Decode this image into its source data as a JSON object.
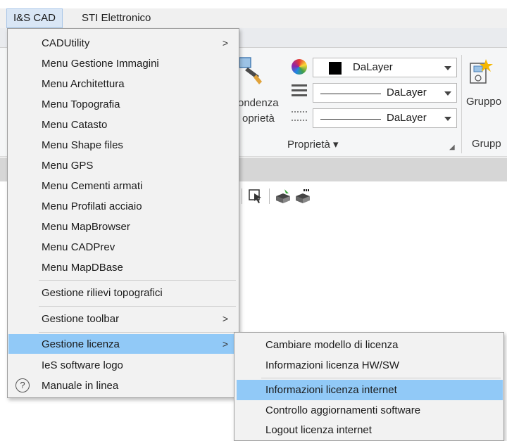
{
  "menubar": {
    "items": [
      {
        "label": "I&S CAD"
      },
      {
        "label": "STI Elettronico"
      }
    ]
  },
  "ribbon": {
    "match_label_1": "ondenza",
    "match_label_2": "oprietà",
    "color_value": "DaLayer",
    "linetype_value": "DaLayer",
    "lineweight_value": "DaLayer",
    "group_proprieta": "Proprietà ▾",
    "group_label_top": "Gruppo",
    "group_label_bottom": "Grupp"
  },
  "menu": {
    "items": [
      {
        "label": "CADUtility",
        "submenu": true
      },
      {
        "label": "Menu Gestione Immagini"
      },
      {
        "label": "Menu Architettura"
      },
      {
        "label": "Menu Topografia"
      },
      {
        "label": "Menu Catasto"
      },
      {
        "label": "Menu Shape files"
      },
      {
        "label": "Menu GPS"
      },
      {
        "label": "Menu Cementi armati"
      },
      {
        "label": "Menu Profilati acciaio"
      },
      {
        "label": "Menu MapBrowser"
      },
      {
        "label": "Menu CADPrev"
      },
      {
        "label": "Menu MapDBase"
      },
      {
        "label": "Gestione rilievi topografici"
      },
      {
        "label": "Gestione toolbar",
        "submenu": true
      },
      {
        "label": "Gestione licenza",
        "submenu": true,
        "highlighted": true
      },
      {
        "label": "IeS software logo"
      },
      {
        "label": "Manuale in linea",
        "icon": "help-icon"
      }
    ],
    "chevron": ">",
    "help_glyph": "?"
  },
  "submenu": {
    "items": [
      {
        "label": "Cambiare modello di licenza"
      },
      {
        "label": "Informazioni licenza HW/SW"
      },
      {
        "label": "Informazioni licenza internet",
        "highlighted": true
      },
      {
        "label": "Controllo aggiornamenti software"
      },
      {
        "label": "Logout licenza internet"
      }
    ]
  },
  "colors": {
    "highlight": "#91c9f7",
    "menu_bg": "#f2f2f2",
    "menubar_active": "#d9e6f5"
  }
}
